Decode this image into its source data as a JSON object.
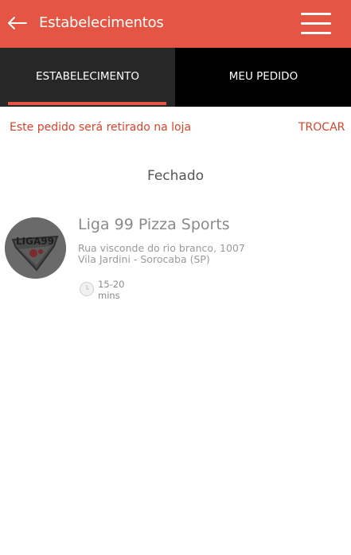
{
  "appbar": {
    "title": "Estabelecimentos",
    "back_icon": "arrow-left-icon",
    "menu_icon": "hamburger-menu-icon",
    "color": "#e45643"
  },
  "tabs": [
    {
      "label": "ESTABELECIMENTO",
      "active": true
    },
    {
      "label": "MEU PEDIDO",
      "active": false
    }
  ],
  "pickup": {
    "message": "Este pedido será retirado na loja",
    "action": "TROCAR"
  },
  "status": "Fechado",
  "store": {
    "name": "Liga 99 Pizza Sports",
    "address_line1": "Rua visconde do rio branco, 1007",
    "address_line2": "Vila Jardini - Sorocaba (SP)",
    "time_range": "15-20",
    "time_unit": "mins",
    "logo_text": "LIGA99",
    "clock_icon": "clock-icon"
  }
}
